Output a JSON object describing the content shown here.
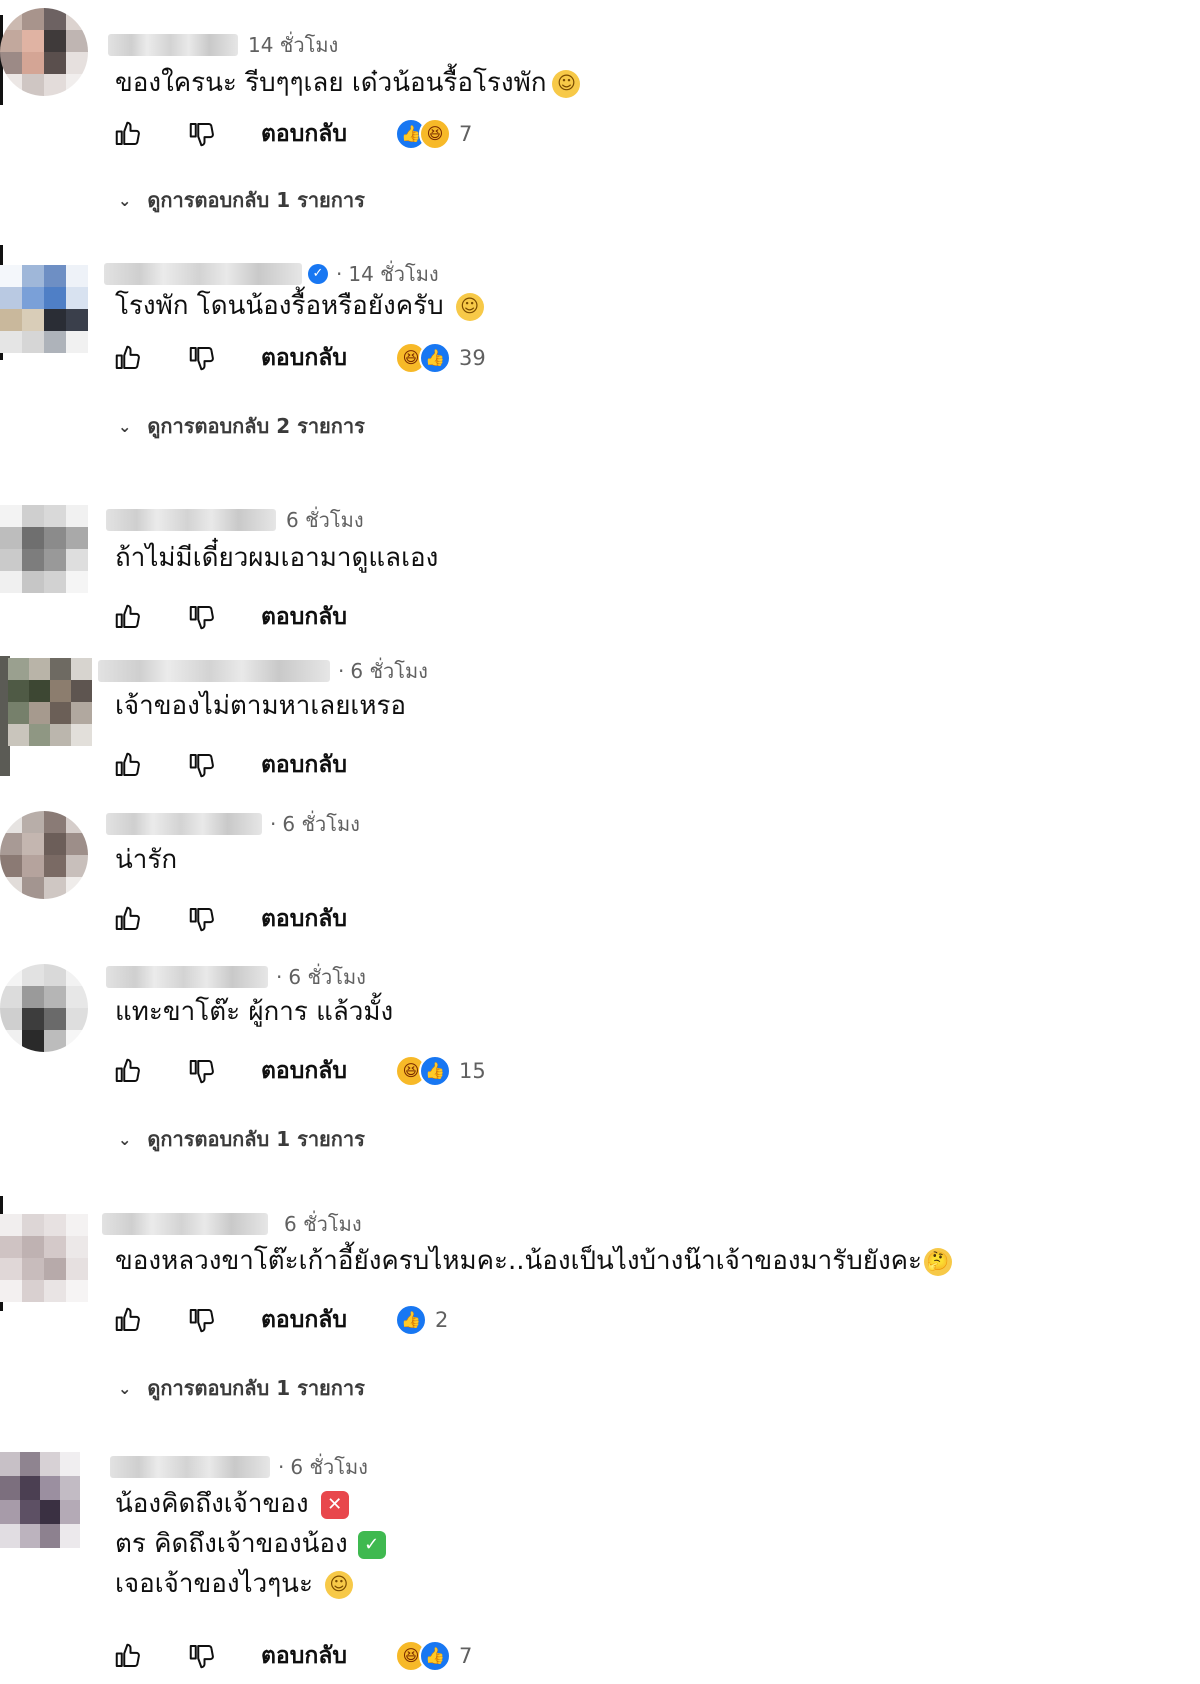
{
  "reply_label": "ตอบกลับ",
  "comments": [
    {
      "time": "14 ชั่วโมง",
      "lines": [
        "ของใครนะ รีบๆๆเลย เด๋วน้อนรื้อโรงพัก"
      ],
      "reactions": [
        "like",
        "haha"
      ],
      "reaction_count": "7",
      "replies_label": "ดูการตอบกลับ 1 รายการ"
    },
    {
      "time": "14 ชั่วโมง",
      "verified": true,
      "lines": [
        "โรงพัก โดนน้องรื้อหรือยังครับ"
      ],
      "reactions": [
        "haha",
        "like"
      ],
      "reaction_count": "39",
      "replies_label": "ดูการตอบกลับ 2 รายการ"
    },
    {
      "time": "6 ชั่วโมง",
      "lines": [
        "ถ้าไม่มีเดี๋ยวผมเอามาดูแลเอง"
      ]
    },
    {
      "time": "6 ชั่วโมง",
      "lines": [
        "เจ้าของไม่ตามหาเลยเหรอ"
      ]
    },
    {
      "time": "6 ชั่วโมง",
      "lines": [
        "น่ารัก"
      ]
    },
    {
      "time": "6 ชั่วโมง",
      "lines": [
        "แทะขาโต๊ะ ผู้การ แล้วมั้ง"
      ],
      "reactions": [
        "haha",
        "like"
      ],
      "reaction_count": "15",
      "replies_label": "ดูการตอบกลับ 1 รายการ"
    },
    {
      "time": "6 ชั่วโมง",
      "lines": [
        "ของหลวงขาโต๊ะเก้าอี้ยังครบไหมคะ..น้องเป็นไงบ้างน๊าเจ้าของมารับยังคะ"
      ],
      "reactions": [
        "like"
      ],
      "reaction_count": "2",
      "replies_label": "ดูการตอบกลับ 1 รายการ"
    },
    {
      "time": "6 ชั่วโมง",
      "lines": [
        "น้องคิดถึงเจ้าของ",
        "ตร คิดถึงเจ้าของน้อง",
        "เจอเจ้าของไวๆนะ"
      ],
      "reactions": [
        "haha",
        "like"
      ],
      "reaction_count": "7"
    }
  ]
}
